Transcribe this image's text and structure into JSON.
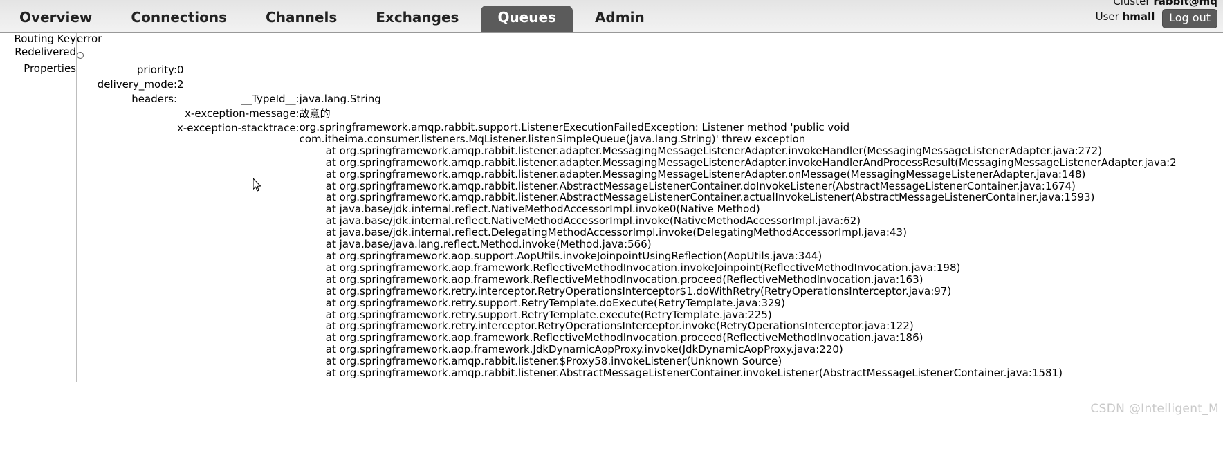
{
  "header": {
    "tabs": [
      {
        "label": "Overview",
        "active": false
      },
      {
        "label": "Connections",
        "active": false
      },
      {
        "label": "Channels",
        "active": false
      },
      {
        "label": "Exchanges",
        "active": false
      },
      {
        "label": "Queues",
        "active": true
      },
      {
        "label": "Admin",
        "active": false
      }
    ],
    "cluster_label": "Cluster",
    "cluster_name": "rabbit@mq",
    "user_label": "User",
    "user_name": "hmall",
    "logout_label": "Log out"
  },
  "message": {
    "rows": [
      {
        "label": "Routing Key",
        "value": "error"
      },
      {
        "label": "Redelivered",
        "value": "○"
      },
      {
        "label": "Properties",
        "value": ""
      }
    ],
    "routing_key_label": "Routing Key",
    "routing_key_value": "error",
    "redelivered_label": "Redelivered",
    "redelivered_value": "○",
    "properties_label": "Properties",
    "properties": [
      {
        "key": "priority:",
        "value": "0"
      },
      {
        "key": "delivery_mode:",
        "value": "2"
      }
    ],
    "headers_key": "headers:",
    "headers": [
      {
        "key": "__TypeId__:",
        "value": "java.lang.String"
      },
      {
        "key": "x-exception-message:",
        "value": "故意的"
      },
      {
        "key": "x-exception-stacktrace:",
        "value": ""
      }
    ],
    "stacktrace_lines": [
      "org.springframework.amqp.rabbit.support.ListenerExecutionFailedException: Listener method 'public void",
      "com.itheima.consumer.listeners.MqListener.listenSimpleQueue(java.lang.String)' threw exception",
      "\tat org.springframework.amqp.rabbit.listener.adapter.MessagingMessageListenerAdapter.invokeHandler(MessagingMessageListenerAdapter.java:272)",
      "\tat org.springframework.amqp.rabbit.listener.adapter.MessagingMessageListenerAdapter.invokeHandlerAndProcessResult(MessagingMessageListenerAdapter.java:2",
      "\tat org.springframework.amqp.rabbit.listener.adapter.MessagingMessageListenerAdapter.onMessage(MessagingMessageListenerAdapter.java:148)",
      "\tat org.springframework.amqp.rabbit.listener.AbstractMessageListenerContainer.doInvokeListener(AbstractMessageListenerContainer.java:1674)",
      "\tat org.springframework.amqp.rabbit.listener.AbstractMessageListenerContainer.actualInvokeListener(AbstractMessageListenerContainer.java:1593)",
      "\tat java.base/jdk.internal.reflect.NativeMethodAccessorImpl.invoke0(Native Method)",
      "\tat java.base/jdk.internal.reflect.NativeMethodAccessorImpl.invoke(NativeMethodAccessorImpl.java:62)",
      "\tat java.base/jdk.internal.reflect.DelegatingMethodAccessorImpl.invoke(DelegatingMethodAccessorImpl.java:43)",
      "\tat java.base/java.lang.reflect.Method.invoke(Method.java:566)",
      "\tat org.springframework.aop.support.AopUtils.invokeJoinpointUsingReflection(AopUtils.java:344)",
      "\tat org.springframework.aop.framework.ReflectiveMethodInvocation.invokeJoinpoint(ReflectiveMethodInvocation.java:198)",
      "\tat org.springframework.aop.framework.ReflectiveMethodInvocation.proceed(ReflectiveMethodInvocation.java:163)",
      "\tat org.springframework.retry.interceptor.RetryOperationsInterceptor$1.doWithRetry(RetryOperationsInterceptor.java:97)",
      "\tat org.springframework.retry.support.RetryTemplate.doExecute(RetryTemplate.java:329)",
      "\tat org.springframework.retry.support.RetryTemplate.execute(RetryTemplate.java:225)",
      "\tat org.springframework.retry.interceptor.RetryOperationsInterceptor.invoke(RetryOperationsInterceptor.java:122)",
      "\tat org.springframework.aop.framework.ReflectiveMethodInvocation.proceed(ReflectiveMethodInvocation.java:186)",
      "\tat org.springframework.aop.framework.JdkDynamicAopProxy.invoke(JdkDynamicAopProxy.java:220)",
      "\tat org.springframework.amqp.rabbit.listener.$Proxy58.invokeListener(Unknown Source)",
      "\tat org.springframework.amqp.rabbit.listener.AbstractMessageListenerContainer.invokeListener(AbstractMessageListenerContainer.java:1581)"
    ]
  },
  "watermark": "CSDN @Intelligent_M"
}
